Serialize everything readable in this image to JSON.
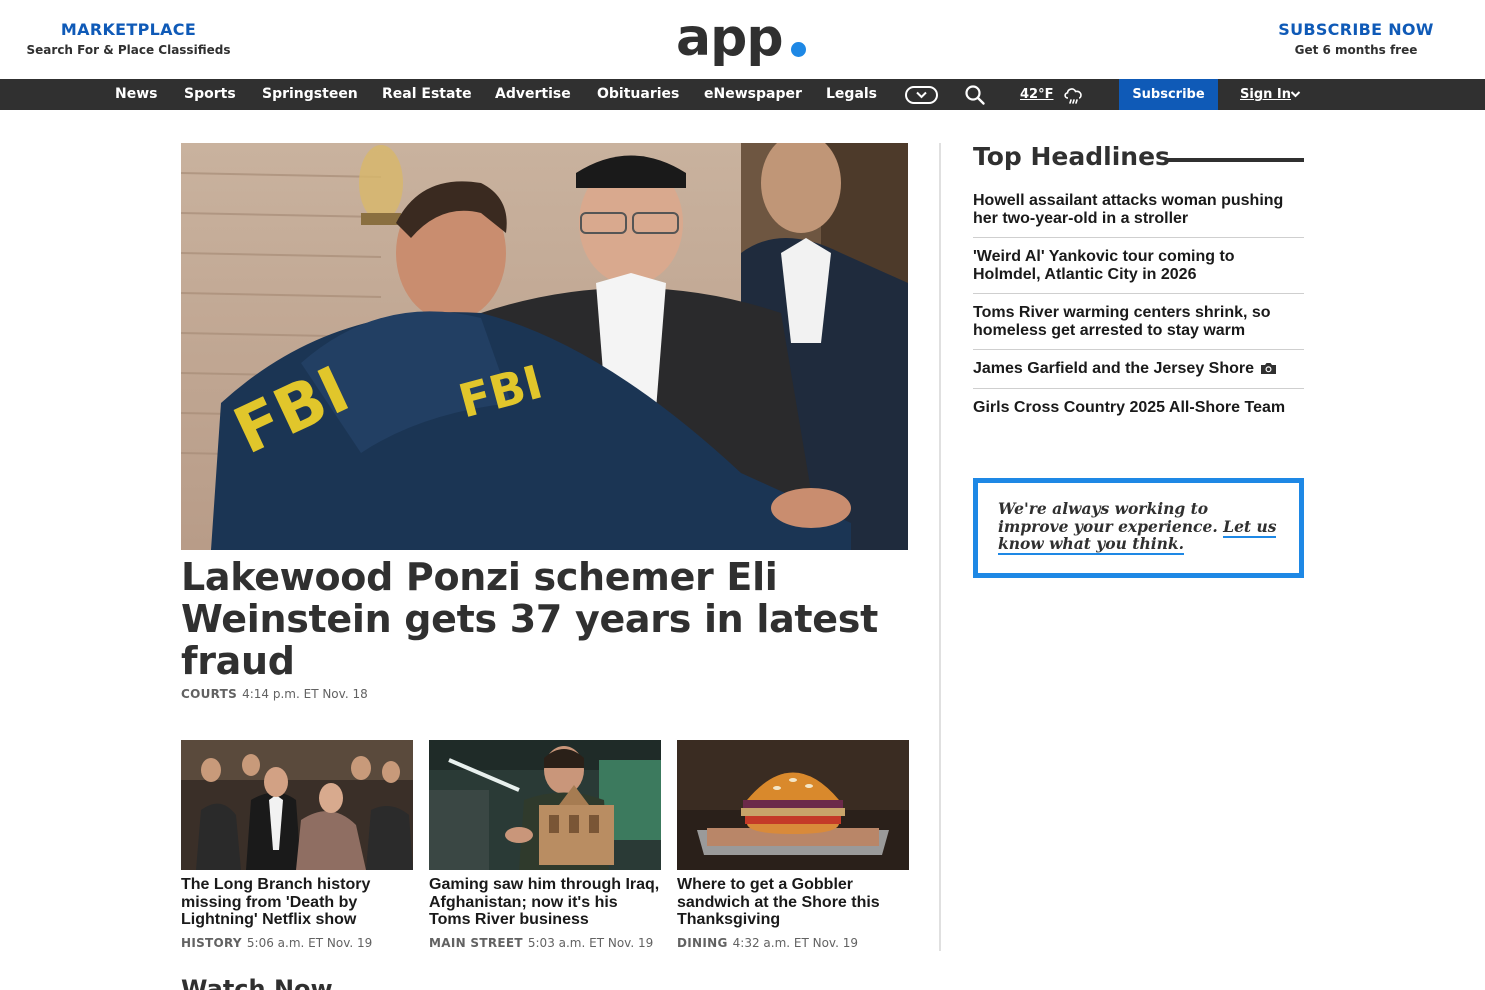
{
  "header": {
    "marketplace_title": "MARKETPLACE",
    "marketplace_sub": "Search For & Place Classifieds",
    "logo_text": "app",
    "subscribe_title": "SUBSCRIBE NOW",
    "subscribe_sub": "Get 6 months free"
  },
  "nav": {
    "items": [
      "News",
      "Sports",
      "Springsteen",
      "Real Estate",
      "Advertise",
      "Obituaries",
      "eNewspaper",
      "Legals"
    ],
    "weather_temp": "42°F",
    "subscribe_label": "Subscribe",
    "signin_label": "Sign In"
  },
  "hero": {
    "headline": "Lakewood Ponzi schemer Eli Weinstein gets 37 years in latest fraud",
    "category": "COURTS",
    "timestamp": "4:14 p.m. ET Nov. 18",
    "jacket_text": "FBI"
  },
  "cards": [
    {
      "headline": "The Long Branch history missing from 'Death by Lightning' Netflix show",
      "category": "HISTORY",
      "timestamp": "5:06 a.m. ET Nov. 19"
    },
    {
      "headline": "Gaming saw him through Iraq, Afghanistan; now it's his Toms River business",
      "category": "MAIN STREET",
      "timestamp": "5:03 a.m. ET Nov. 19"
    },
    {
      "headline": "Where to get a Gobbler sandwich at the Shore this Thanksgiving",
      "category": "DINING",
      "timestamp": "4:32 a.m. ET Nov. 19"
    }
  ],
  "section": {
    "watch_now": "Watch Now"
  },
  "top_headlines": {
    "title": "Top Headlines",
    "items": [
      "Howell assailant attacks woman pushing her two-year-old in a stroller",
      "'Weird Al' Yankovic tour coming to Holmdel, Atlantic City in 2026",
      "Toms River warming centers shrink, so homeless get arrested to stay warm",
      "James Garfield and the Jersey Shore",
      "Girls Cross Country 2025 All-Shore Team"
    ]
  },
  "feedback": {
    "text": "We're always working to improve your experience.",
    "link": "Let us know what you think."
  },
  "colors": {
    "brand_blue": "#0f5ab7",
    "accent_blue": "#1e88e5",
    "nav_bg": "#303030"
  }
}
